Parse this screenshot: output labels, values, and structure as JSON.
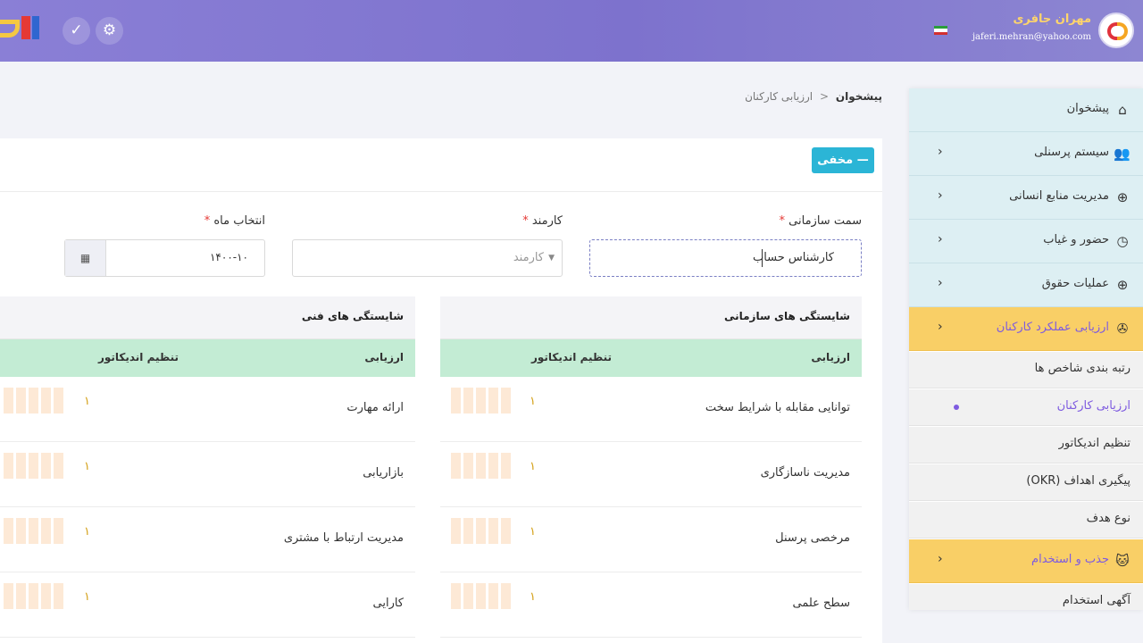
{
  "header": {
    "user_name": "مهران جافری",
    "user_email": "jaferi.mehran@yahoo.com"
  },
  "icons": {
    "settings": "gear-icon",
    "tasks": "check-circle-icon",
    "language": "flag-icon"
  },
  "sidebar": {
    "items": [
      {
        "label": "پیشخوان",
        "icon": "home-icon"
      },
      {
        "label": "سیستم پرسنلی",
        "icon": "users-icon"
      },
      {
        "label": "مدیریت منابع انسانی",
        "icon": "life-ring-icon"
      },
      {
        "label": "حضور و غیاب",
        "icon": "clock-icon"
      },
      {
        "label": "عملیات حقوق",
        "icon": "life-ring-icon"
      },
      {
        "label": "ارزیابی عملکرد کارکنان",
        "icon": "aperture-icon"
      },
      {
        "label": "جذب و استخدام",
        "icon": "cat-icon"
      }
    ],
    "sub_items_eval": [
      {
        "label": "رتبه بندی شاخص ها"
      },
      {
        "label": "ارزیابی کارکنان"
      },
      {
        "label": "تنظیم اندیکاتور"
      },
      {
        "label": "پیگیری اهداف (OKR)"
      },
      {
        "label": "نوع هدف"
      }
    ],
    "sub_items_recruit": [
      {
        "label": "آگهی استخدام"
      }
    ]
  },
  "breadcrumb": {
    "home": "پیشخوان",
    "separator": "<",
    "current": "ارزیابی کارکنان"
  },
  "card": {
    "hide_button": "— مخفی"
  },
  "form": {
    "org_position": {
      "label": "سمت سازمانی",
      "value": "کارشناس حساب"
    },
    "employee": {
      "label": "کارمند",
      "placeholder": "کارمند"
    },
    "month": {
      "label": "انتخاب ماه",
      "value": "۱۴۰۰-۱۰"
    },
    "required_mark": "*"
  },
  "tables": {
    "col_eval": "ارزیابی",
    "col_indicator": "تنظیم اندیکاتور",
    "organizational": {
      "title": "شایستگی های سازمانی",
      "rows": [
        {
          "name": "توانایی مقابله با شرایط سخت",
          "value": "۱"
        },
        {
          "name": "مدیریت ناسازگاری",
          "value": "۱"
        },
        {
          "name": "مرخصی پرسنل",
          "value": "۱"
        },
        {
          "name": "سطح علمی",
          "value": "۱"
        }
      ]
    },
    "technical": {
      "title": "شایستگی های فنی",
      "rows": [
        {
          "name": "ارائه مهارت",
          "value": "۱"
        },
        {
          "name": "بازاریابی",
          "value": "۱"
        },
        {
          "name": "مدیریت ارتباط با مشتری",
          "value": "۱"
        },
        {
          "name": "کارایی",
          "value": "۱"
        }
      ]
    }
  }
}
